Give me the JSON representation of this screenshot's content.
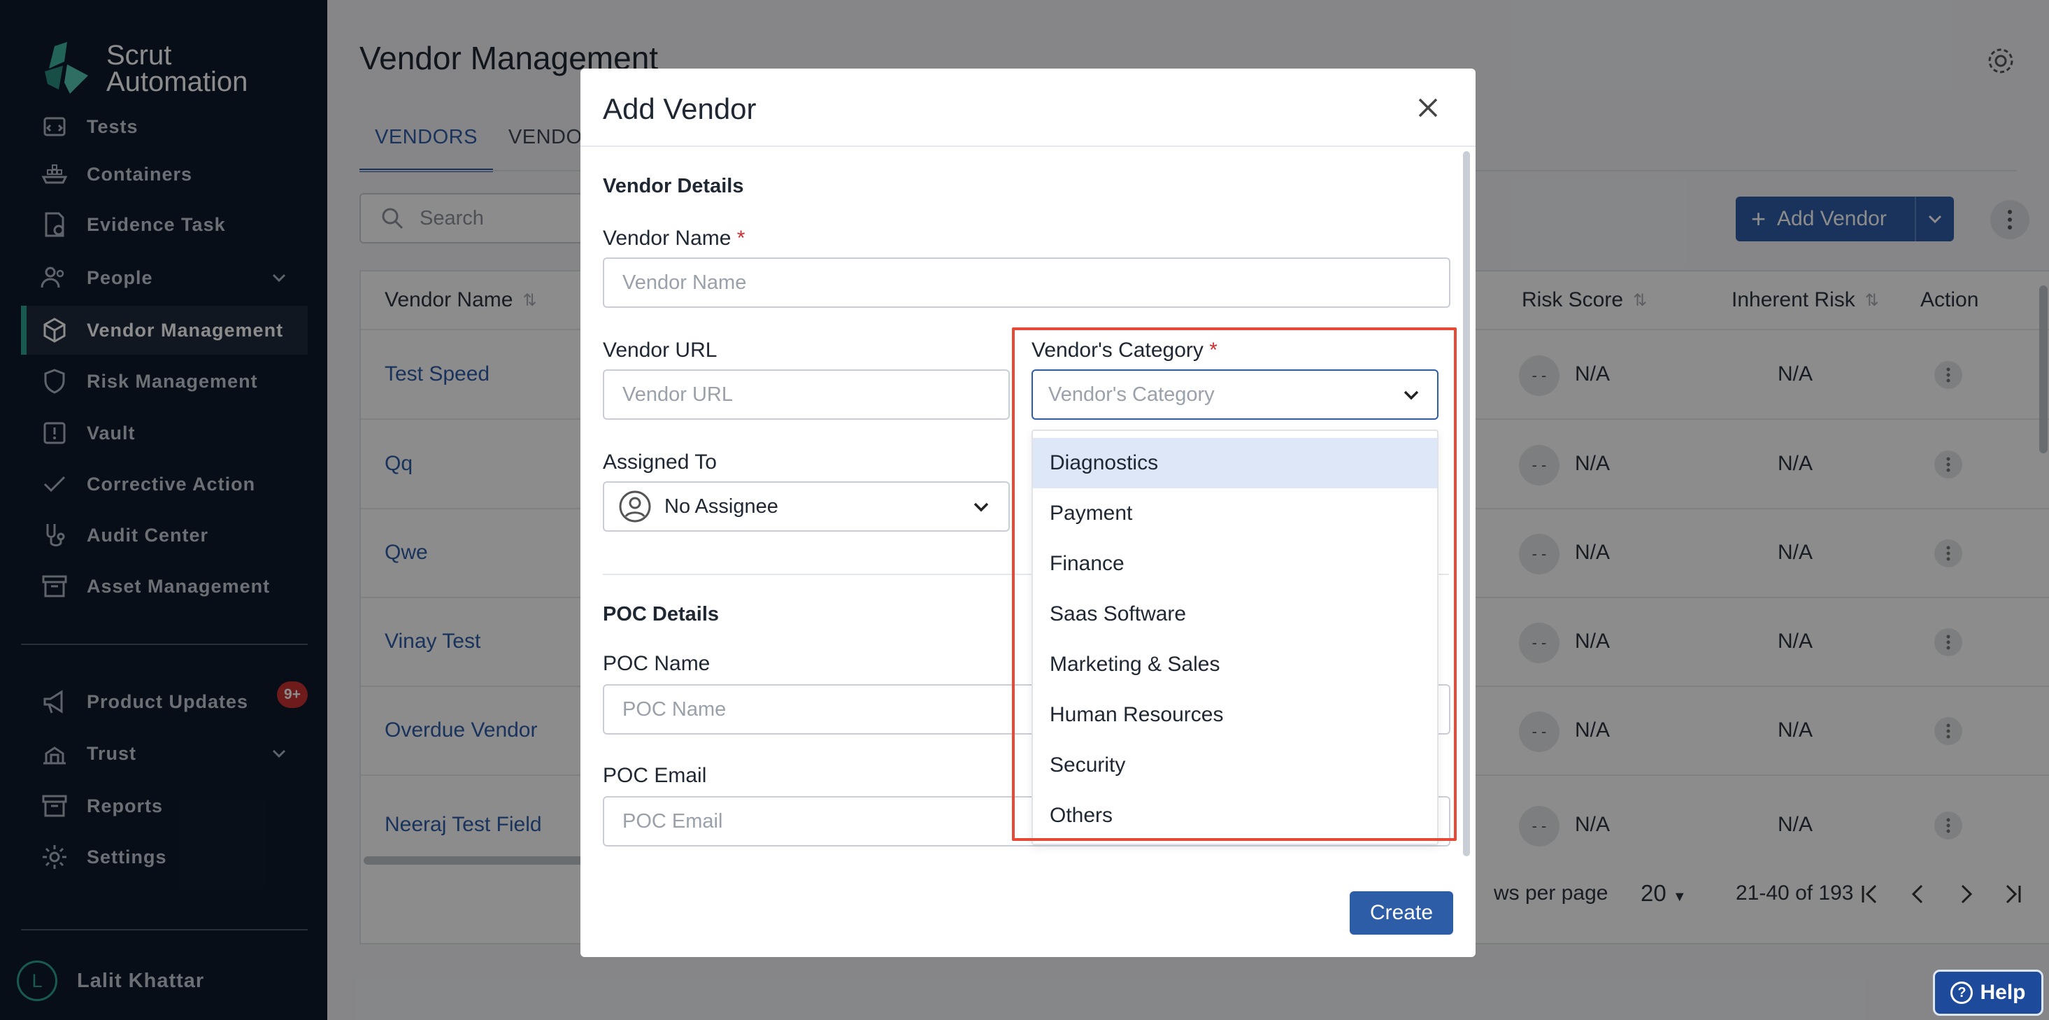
{
  "brand": {
    "line1": "Scrut",
    "line2": "Automation"
  },
  "sidebar": {
    "items": [
      {
        "label": "Tests",
        "icon": "tests-icon"
      },
      {
        "label": "Containers",
        "icon": "containers-icon"
      },
      {
        "label": "Evidence Task",
        "icon": "evidence-task-icon"
      },
      {
        "label": "People",
        "icon": "people-icon"
      },
      {
        "label": "Vendor Management",
        "icon": "vendor-management-icon",
        "active": true
      },
      {
        "label": "Risk Management",
        "icon": "shield-icon"
      },
      {
        "label": "Vault",
        "icon": "vault-icon"
      },
      {
        "label": "Corrective Action",
        "icon": "check-icon"
      },
      {
        "label": "Audit Center",
        "icon": "audit-icon"
      },
      {
        "label": "Asset Management",
        "icon": "archive-icon"
      }
    ],
    "bottom_items": [
      {
        "label": "Product Updates",
        "icon": "megaphone-icon",
        "badge": "9+"
      },
      {
        "label": "Trust",
        "icon": "trust-icon"
      },
      {
        "label": "Reports",
        "icon": "reports-icon"
      },
      {
        "label": "Settings",
        "icon": "settings-icon"
      }
    ],
    "user": {
      "initial": "L",
      "name": "Lalit Khattar"
    }
  },
  "page": {
    "title": "Vendor Management",
    "tabs": [
      "VENDORS",
      "VENDORS"
    ],
    "search_placeholder": "Search",
    "add_vendor_label": "Add Vendor"
  },
  "table": {
    "headers": {
      "vendor_name": "Vendor Name",
      "risk_score": "Risk Score",
      "inherent_risk": "Inherent Risk",
      "action": "Action"
    },
    "rows": [
      {
        "name": "Test Speed",
        "score": "- -",
        "risk": "N/A",
        "inherent": "N/A"
      },
      {
        "name": "Qq",
        "score": "- -",
        "risk": "N/A",
        "inherent": "N/A"
      },
      {
        "name": "Qwe",
        "score": "- -",
        "risk": "N/A",
        "inherent": "N/A"
      },
      {
        "name": "Vinay Test",
        "score": "- -",
        "risk": "N/A",
        "inherent": "N/A"
      },
      {
        "name": "Overdue Vendor",
        "score": "- -",
        "risk": "N/A",
        "inherent": "N/A"
      },
      {
        "name": "Neeraj Test Field",
        "score": "- -",
        "risk": "N/A",
        "inherent": "N/A"
      }
    ],
    "pagination": {
      "rows_label": "ws per page",
      "rows_value": "20",
      "range": "21-40 of 193"
    }
  },
  "modal": {
    "title": "Add Vendor",
    "vendor_details": "Vendor Details",
    "vendor_name_label": "Vendor Name",
    "vendor_name_placeholder": "Vendor Name",
    "vendor_url_label": "Vendor URL",
    "vendor_url_placeholder": "Vendor URL",
    "category_label": "Vendor's Category",
    "category_placeholder": "Vendor's Category",
    "required_mark": "*",
    "assigned_label": "Assigned To",
    "assigned_value": "No Assignee",
    "poc_details": "POC Details",
    "poc_name_label": "POC Name",
    "poc_name_placeholder": "POC Name",
    "poc_email_label": "POC Email",
    "poc_email_placeholder": "POC Email",
    "create_label": "Create",
    "category_options": [
      "Diagnostics",
      "Payment",
      "Finance",
      "Saas Software",
      "Marketing & Sales",
      "Human Resources",
      "Security",
      "Others"
    ]
  },
  "help": {
    "label": "Help"
  },
  "colors": {
    "accent": "#2e5da8",
    "sidebar": "#0f1b2d",
    "highlight": "#e64a36",
    "brand": "#2fa58f"
  }
}
